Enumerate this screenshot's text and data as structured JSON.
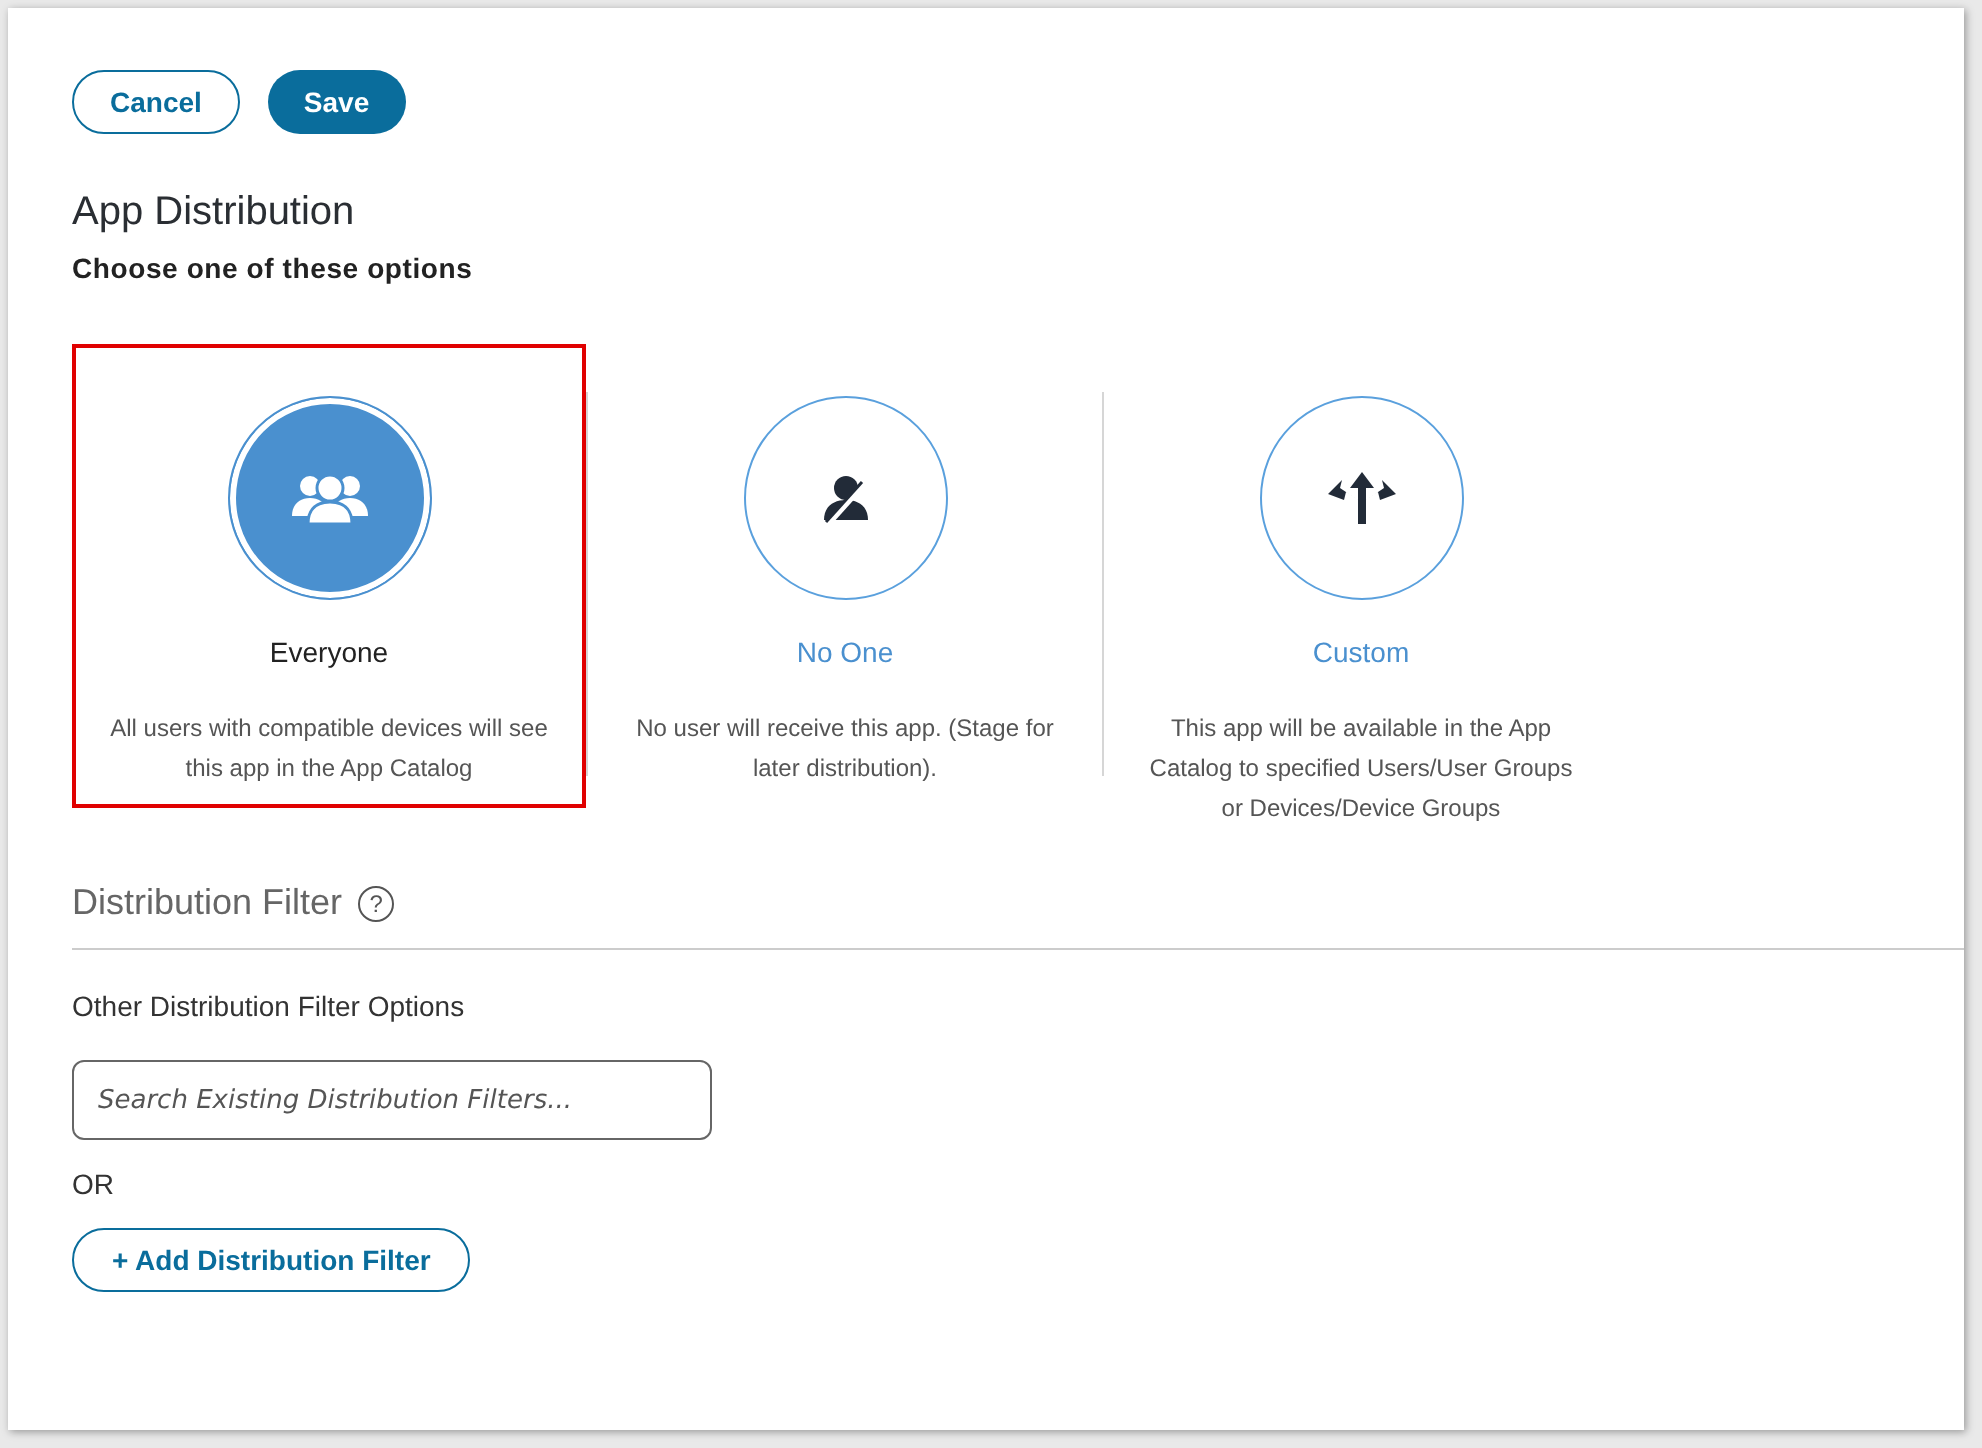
{
  "buttons": {
    "cancel": "Cancel",
    "save": "Save"
  },
  "title": "App Distribution",
  "subtitle": "Choose one of these options",
  "options": [
    {
      "kind": "group",
      "label": "Everyone",
      "description": "All users with compatible devices will see this app in the App Catalog",
      "selected": true
    },
    {
      "kind": "nouser",
      "label": "No One",
      "description": "No user will receive this app. (Stage for later distribution).",
      "selected": false
    },
    {
      "kind": "split",
      "label": "Custom",
      "description": "This app will be available in the App Catalog to specified Users/User Groups or Devices/Device Groups",
      "selected": false
    }
  ],
  "filter": {
    "title": "Distribution Filter",
    "help": "?",
    "subtitle": "Other Distribution Filter Options",
    "placeholder": "Search Existing Distribution Filters...",
    "or": "OR",
    "add_button": "+ Add Distribution Filter"
  }
}
